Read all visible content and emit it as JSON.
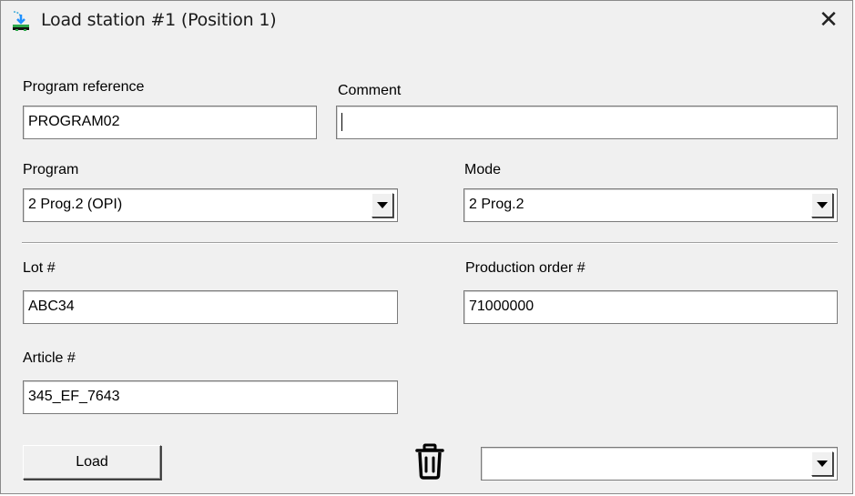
{
  "window": {
    "title": "Load station #1 (Position 1)",
    "icon": "load-station-icon",
    "close_symbol": "✕"
  },
  "form": {
    "program_reference": {
      "label": "Program reference",
      "value": "PROGRAM02"
    },
    "comment": {
      "label": "Comment",
      "value": ""
    },
    "program": {
      "label": "Program",
      "selected": "2 Prog.2 (OPI)"
    },
    "mode": {
      "label": "Mode",
      "selected": "2 Prog.2"
    },
    "lot": {
      "label": "Lot #",
      "value": "ABC34"
    },
    "production_order": {
      "label": "Production order #",
      "value": "71000000"
    },
    "article": {
      "label": "Article #",
      "value": "345_EF_7643"
    }
  },
  "footer": {
    "load_label": "Load",
    "trash_icon": "trash-icon",
    "extra_select": ""
  }
}
